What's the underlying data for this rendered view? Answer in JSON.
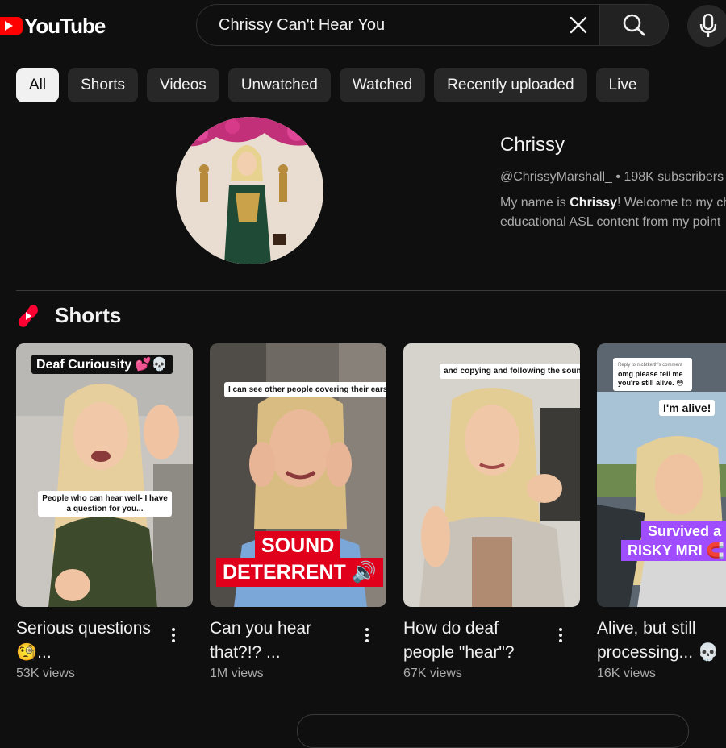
{
  "header": {
    "logo_text": "YouTube",
    "search_value": "Chrissy Can't Hear You",
    "icons": [
      "clear-icon",
      "search-icon",
      "mic-icon"
    ]
  },
  "chips": [
    "All",
    "Shorts",
    "Videos",
    "Unwatched",
    "Watched",
    "Recently uploaded",
    "Live"
  ],
  "channel": {
    "name": "Chrissy",
    "handle": "@ChrissyMarshall_",
    "separator": "•",
    "subscribers": "198K subscribers",
    "desc_pre": "My name is ",
    "desc_bold": "Chrissy",
    "desc_post": "! Welcome to my ch",
    "desc_line2": "educational ASL content from my point"
  },
  "shorts": {
    "title": "Shorts",
    "items": [
      {
        "title": "Serious questions 🧐...",
        "views": "53K views",
        "caption_top": "Deaf Curiousity 💕💀",
        "caption_mid": "People who can hear well- I have a question for you..."
      },
      {
        "title": "Can you hear that?!? ...",
        "views": "1M views",
        "caption_top": "I can see other people covering their ears...",
        "caption_big1": "SOUND",
        "caption_big2": "DETERRENT 🔊"
      },
      {
        "title": "How do deaf people \"hear\"?",
        "views": "67K views",
        "caption_top": "and copying and following the sound with"
      },
      {
        "title": "Alive, but still processing... 💀",
        "views": "16K views",
        "reply_label": "Reply to mcbtkeith's comment",
        "reply_text": "omg please tell me you're still alive. 😳",
        "caption_alive": "I'm alive!",
        "caption_big1": "Survived a",
        "caption_big2": "RISKY MRI 🧲"
      }
    ]
  },
  "colors": {
    "background": "#0f0f0f",
    "chip": "#272727",
    "brand": "#ff0000",
    "caption_red": "#e0001b",
    "caption_purple": "#a04dff"
  }
}
